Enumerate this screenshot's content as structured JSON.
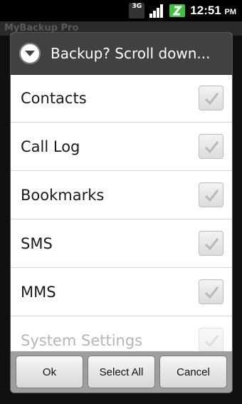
{
  "status_bar": {
    "network_label": "3G",
    "time": "12:51",
    "ampm": "PM",
    "icons": [
      "3g-data-icon",
      "signal-icon",
      "battery-icon"
    ]
  },
  "background_app": {
    "title": "MyBackup Pro"
  },
  "dialog": {
    "title": "Backup? Scroll down...",
    "icon": "chevron-down-icon",
    "items": [
      {
        "label": "Contacts",
        "checked": true
      },
      {
        "label": "Call Log",
        "checked": true
      },
      {
        "label": "Bookmarks",
        "checked": true
      },
      {
        "label": "SMS",
        "checked": true
      },
      {
        "label": "MMS",
        "checked": true
      },
      {
        "label": "System Settings",
        "checked": true
      }
    ],
    "buttons": {
      "ok": "Ok",
      "select_all": "Select All",
      "cancel": "Cancel"
    }
  },
  "colors": {
    "accent_battery": "#3fbf3f",
    "dialog_header": "#414141"
  }
}
